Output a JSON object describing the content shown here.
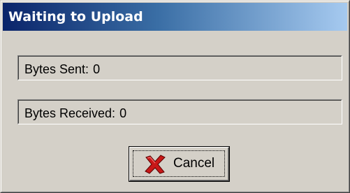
{
  "window": {
    "title": "Waiting to Upload"
  },
  "fields": {
    "bytes_sent": {
      "label": "Bytes Sent:",
      "value": "0"
    },
    "bytes_received": {
      "label": "Bytes Received:",
      "value": "0"
    }
  },
  "buttons": {
    "cancel": {
      "label": "Cancel",
      "icon": "cancel-x-icon",
      "icon_color": "#c81818"
    }
  },
  "colors": {
    "title_gradient_start": "#0a246a",
    "title_gradient_end": "#a6caf0",
    "face": "#d4d0c8"
  }
}
